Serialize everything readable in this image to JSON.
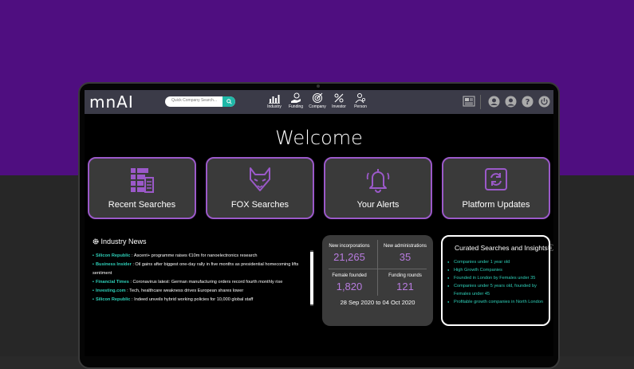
{
  "header": {
    "logo": "mnAI",
    "search_placeholder": "Quick Company Search...",
    "nav": [
      {
        "label": "Industry",
        "icon": "bar-chart-icon"
      },
      {
        "label": "Funding",
        "icon": "hand-money-icon"
      },
      {
        "label": "Company",
        "icon": "target-icon"
      },
      {
        "label": "Investor",
        "icon": "investor-icon"
      },
      {
        "label": "Person",
        "icon": "person-search-icon"
      }
    ],
    "right_icons": [
      "newspaper-icon",
      "support-icon",
      "user-icon",
      "help-icon",
      "power-icon"
    ]
  },
  "welcome": "Welcome",
  "cards": [
    {
      "label": "Recent Searches",
      "icon": "list-icon"
    },
    {
      "label": "FOX Searches",
      "icon": "fox-icon"
    },
    {
      "label": "Your Alerts",
      "icon": "bell-icon"
    },
    {
      "label": "Platform Updates",
      "icon": "refresh-icon"
    }
  ],
  "industry_news": {
    "title": "Industry News",
    "items": [
      {
        "source": "Silicon Republic",
        "text": " : Ascent+ programme raises €10m for nanoelectronics research"
      },
      {
        "source": "Business Insider",
        "text": " : Oil gains after biggest one-day rally in five months as presidential homecoming lifts sentiment"
      },
      {
        "source": "Financial Times",
        "text": " : Coronavirus latest: German manufacturing orders record fourth monthly rise"
      },
      {
        "source": "Investing.com",
        "text": " : Tech, healthcare weakness drives European shares lower"
      },
      {
        "source": "Silicon Republic",
        "text": " : Indeed unveils hybrid working policies for 10,000 global staff"
      }
    ]
  },
  "stats": {
    "new_incorporations_label": "New incorporations",
    "new_incorporations": "21,265",
    "new_administrations_label": "New administrations",
    "new_administrations": "35",
    "female_founded_label": "Female founded",
    "female_founded": "1,820",
    "funding_rounds_label": "Funding rounds",
    "funding_rounds": "121",
    "date_range": "28 Sep 2020 to 04 Oct 2020"
  },
  "curated": {
    "title": "Curated Searches and Insights",
    "info_icon": "ⓘ",
    "items": [
      "Companies under 1 year old",
      "High Growth Companies",
      "Founded in London by Females under 35",
      "Companies under 5 years old, founded by Females under 45",
      "Profitable growth companies in North London"
    ]
  },
  "colors": {
    "accent": "#9b59c9",
    "teal": "#2ecfb8",
    "purple_bg": "#4f0e80"
  }
}
